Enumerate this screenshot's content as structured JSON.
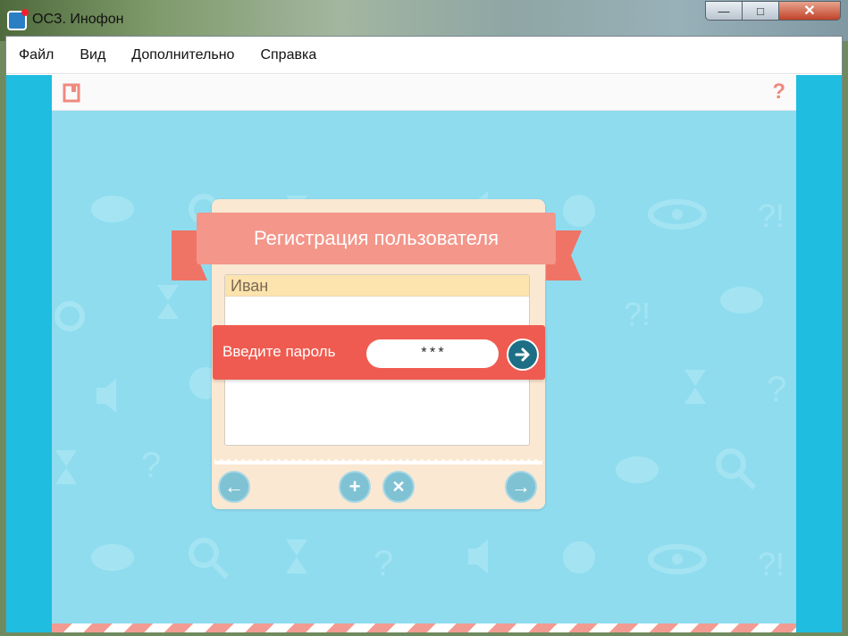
{
  "window": {
    "title": "ОСЗ. Инофон",
    "minimize": "—",
    "maximize": "□",
    "close": "✕"
  },
  "menu": [
    "Файл",
    "Вид",
    "Дополнительно",
    "Справка"
  ],
  "toolbar": {
    "left_icon": "book-icon",
    "help": "?"
  },
  "dialog": {
    "title": "Регистрация пользователя",
    "users": [
      "Иван"
    ],
    "password_label": "Введите пароль",
    "password_value": "***",
    "go_icon": "arrow-right-icon",
    "buttons": {
      "back": "←",
      "add": "+",
      "delete": "✕",
      "next": "→"
    }
  },
  "colors": {
    "accent_blue": "#1fbde0",
    "canvas": "#8fdcef",
    "ribbon": "#f4968a",
    "password_bar": "#ef5b50"
  }
}
